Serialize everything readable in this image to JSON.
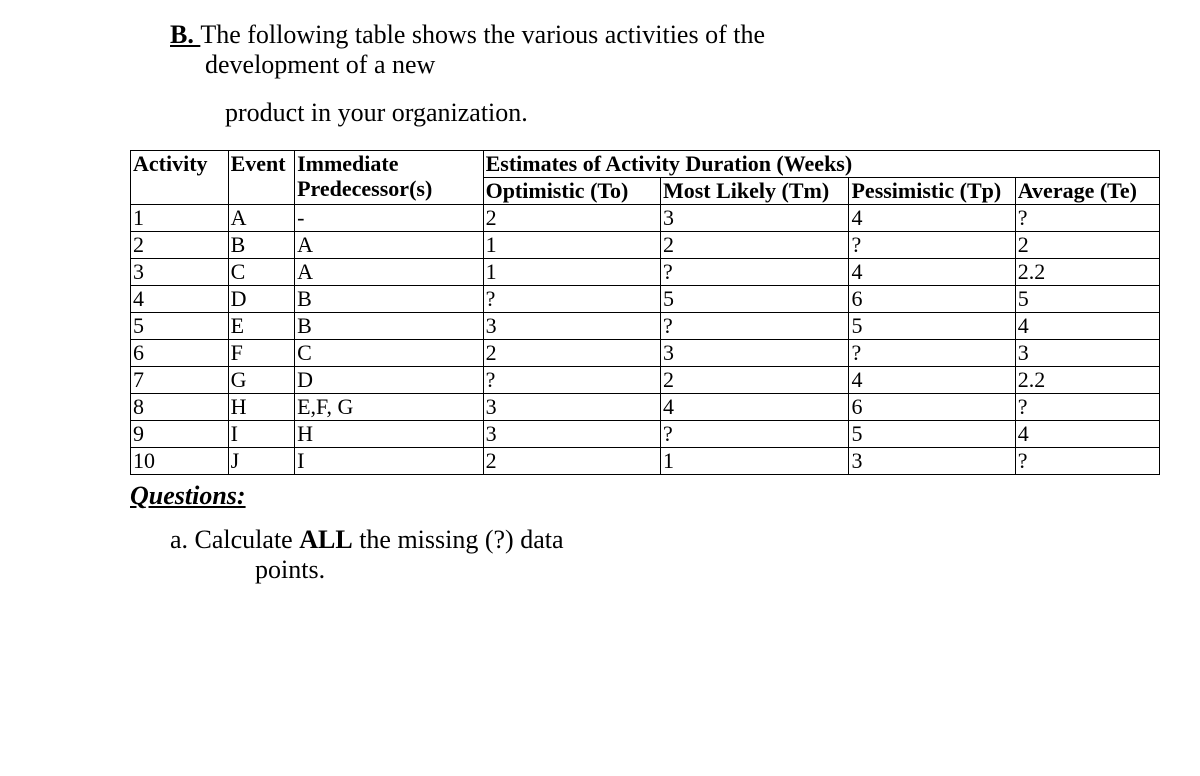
{
  "heading": {
    "label": "B. ",
    "line1a": "The following table shows the various activities of the",
    "line2": "development of a new",
    "line3": "product in your organization."
  },
  "columns": {
    "activity": "Activity",
    "event": "Event",
    "predecessor": "Immediate Predecessor(s)",
    "estimates": "Estimates of Activity Duration (Weeks)",
    "optimistic": "Optimistic (To)",
    "mostlikely": "Most Likely (Tm)",
    "pessimistic": "Pessimistic (Tp)",
    "average": "Average (Te)"
  },
  "rows": [
    {
      "activity": "1",
      "event": "A",
      "pred": "-",
      "to": "2",
      "tm": "3",
      "tp": "4",
      "te": "?"
    },
    {
      "activity": "2",
      "event": "B",
      "pred": "A",
      "to": "1",
      "tm": "2",
      "tp": "?",
      "te": "2"
    },
    {
      "activity": "3",
      "event": "C",
      "pred": "A",
      "to": "1",
      "tm": "?",
      "tp": "4",
      "te": "2.2"
    },
    {
      "activity": "4",
      "event": "D",
      "pred": "B",
      "to": "?",
      "tm": "5",
      "tp": "6",
      "te": "5"
    },
    {
      "activity": "5",
      "event": "E",
      "pred": "B",
      "to": "3",
      "tm": "?",
      "tp": "5",
      "te": "4"
    },
    {
      "activity": "6",
      "event": "F",
      "pred": "C",
      "to": "2",
      "tm": "3",
      "tp": "?",
      "te": "3"
    },
    {
      "activity": "7",
      "event": "G",
      "pred": "D",
      "to": "?",
      "tm": "2",
      "tp": "4",
      "te": "2.2"
    },
    {
      "activity": "8",
      "event": "H",
      "pred": "E,F, G",
      "to": "3",
      "tm": "4",
      "tp": "6",
      "te": "?"
    },
    {
      "activity": "9",
      "event": "I",
      "pred": "H",
      "to": "3",
      "tm": "?",
      "tp": "5",
      "te": "4"
    },
    {
      "activity": "10",
      "event": "J",
      "pred": "I",
      "to": "2",
      "tm": "1",
      "tp": "3",
      "te": "?"
    }
  ],
  "questions": {
    "title": "Questions:",
    "a_prefix": "a. Calculate ",
    "a_bold": "ALL",
    "a_suffix": " the missing (?) data",
    "a_line2": "points."
  }
}
